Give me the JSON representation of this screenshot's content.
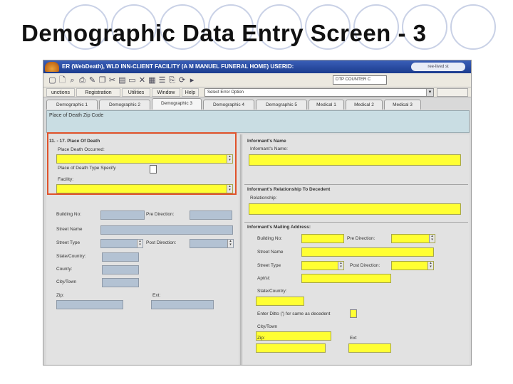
{
  "slide": {
    "title": "Demographic Data Entry Screen - 3"
  },
  "window": {
    "title": "ER (WebDeath), WLD INN-CLIENT FACILITY (A M MANUEL FUNERAL HOME) USERID:",
    "status_pill": "ree-lived  st"
  },
  "toolbar": {
    "dtp_counter": "DTP COUNTER C"
  },
  "menu": {
    "items": [
      "unctions",
      "Registration",
      "Utilities",
      "Window",
      "Help"
    ],
    "error_select": "Select Error Option"
  },
  "tabs": [
    "Demographic 1",
    "Demographic 2",
    "Demographic 3",
    "Demographic 4",
    "Demographic 5",
    "Medical 1",
    "Medical 2",
    "Medical 3"
  ],
  "active_tab": 2,
  "zip_panel": {
    "label": "Place of Death Zip Code"
  },
  "place_of_death": {
    "heading": "11. - 17. Place Of Death",
    "occurred_label": "Place Death Occurred:",
    "type_label": "Place of Death Type Specify",
    "facility_label": "Facility:"
  },
  "address": {
    "building_label": "Building No:",
    "pre_direction_label": "Pre Direction:",
    "street_name_label": "Street Name",
    "street_type_label": "Street Type",
    "post_direction_label": "Post Direction:",
    "state_label": "State/Country:",
    "county_label": "County:",
    "city_label": "City/Town",
    "zip_label": "Zip:",
    "ext_label": "Ext:"
  },
  "informant": {
    "name_heading": "Informant's Name",
    "name_label": "Informant's Name:",
    "relationship_heading": "Informant's Relationship To Decedent",
    "relationship_label": "Relationship:",
    "mailing_heading": "Informant's Mailing Address:",
    "building_label": "Building No:",
    "pre_direction_label": "Pre Direction:",
    "street_name_label": "Street Name",
    "street_type_label": "Street Type",
    "post_direction_label": "Post Direction:",
    "apt_label": "Apt/st:",
    "state_label": "State/Country:",
    "ditto_label": "Enter Ditto (') for same as decedent",
    "city_label": "City/Town",
    "zip_label": "Zip:",
    "ext_label": "Ext"
  }
}
